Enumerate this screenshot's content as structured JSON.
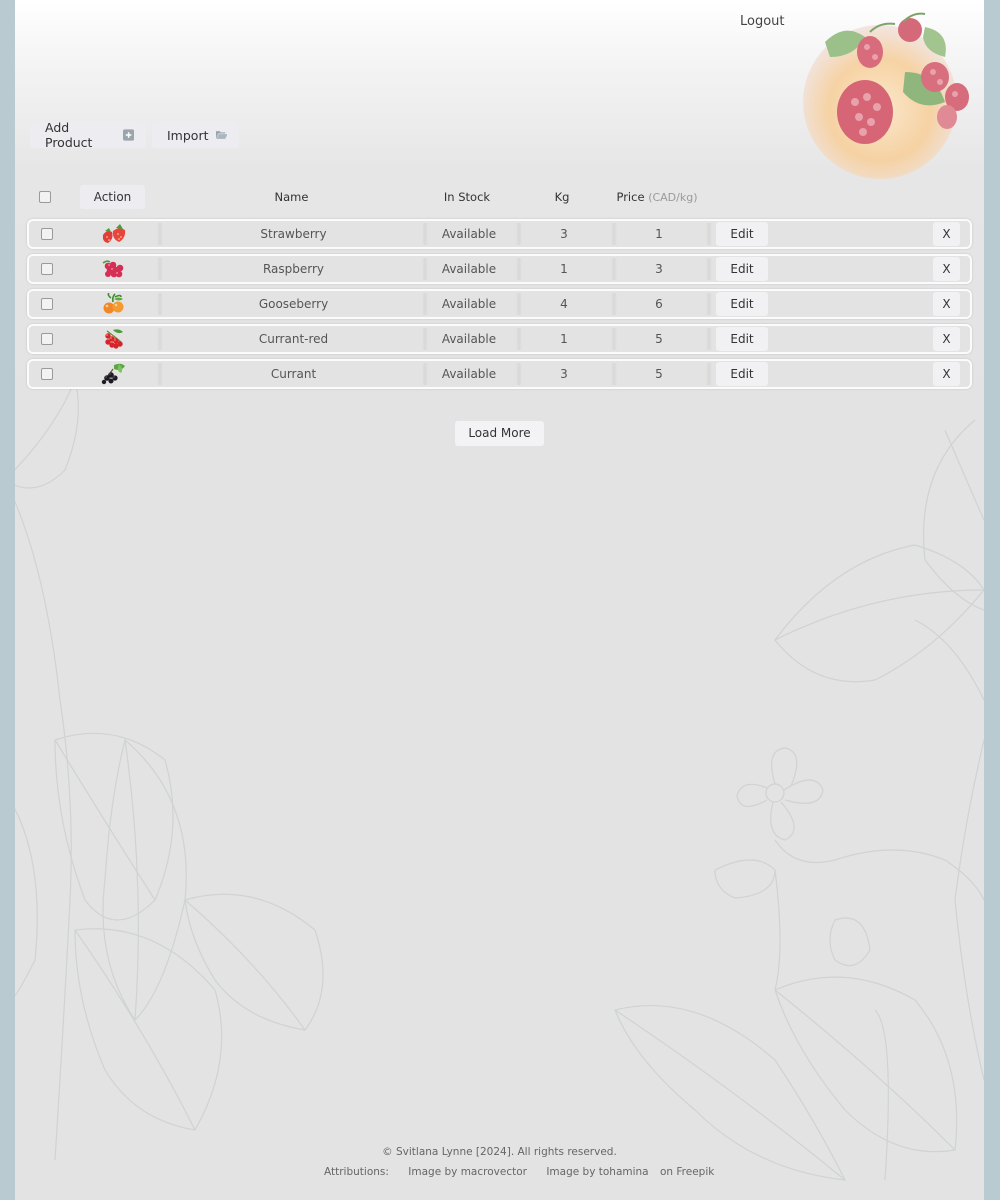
{
  "header": {
    "logout_label": "Logout"
  },
  "toolbar": {
    "add_product_label": "Add Product",
    "import_label": "Import"
  },
  "table": {
    "headers": {
      "action": "Action",
      "name": "Name",
      "in_stock": "In Stock",
      "kg": "Kg",
      "price": "Price",
      "price_unit": "(CAD/kg)"
    },
    "rows": [
      {
        "name": "Strawberry",
        "in_stock": "Available",
        "kg": "3",
        "price": "1",
        "edit": "Edit",
        "delete": "X",
        "icon": "strawberry-icon"
      },
      {
        "name": "Raspberry",
        "in_stock": "Available",
        "kg": "1",
        "price": "3",
        "edit": "Edit",
        "delete": "X",
        "icon": "raspberry-icon"
      },
      {
        "name": "Gooseberry",
        "in_stock": "Available",
        "kg": "4",
        "price": "6",
        "edit": "Edit",
        "delete": "X",
        "icon": "gooseberry-icon"
      },
      {
        "name": "Currant-red",
        "in_stock": "Available",
        "kg": "1",
        "price": "5",
        "edit": "Edit",
        "delete": "X",
        "icon": "red-currant-icon"
      },
      {
        "name": "Currant",
        "in_stock": "Available",
        "kg": "3",
        "price": "5",
        "edit": "Edit",
        "delete": "X",
        "icon": "black-currant-icon"
      }
    ]
  },
  "load_more_label": "Load More",
  "footer": {
    "copyright": "© Svitlana Lynne [2024]. All rights reserved.",
    "attributions_label": "Attributions:",
    "attr_macrovector": "Image by macrovector",
    "attr_tohamina": "Image by tohamina",
    "attr_freepik": "on Freepik"
  },
  "colors": {
    "outer_background": "#b9cbd1",
    "page_background": "#e3e3e3",
    "button_background": "#ececf1"
  }
}
